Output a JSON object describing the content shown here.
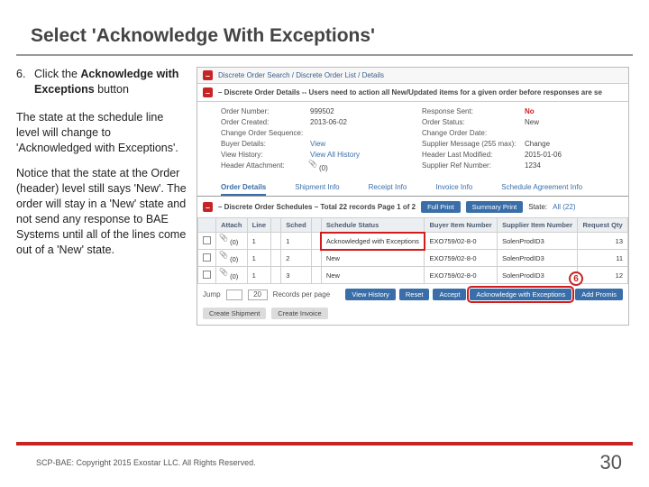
{
  "title": "Select 'Acknowledge With Exceptions'",
  "step": {
    "num": "6.",
    "text_pre": "Click the ",
    "bold": "Acknowledge with Exceptions",
    "text_post": " button"
  },
  "para1": "The state at the schedule line level will change to 'Acknowledged with Exceptions'.",
  "para2": "Notice that the state at the Order (header) level still says 'New'. The order will stay in a 'New' state and not send any response to BAE Systems until all of the lines come out of a 'New' state.",
  "crumb": "Discrete Order Search / Discrete Order List / Details",
  "notice": "– Discrete Order Details -- Users need to action all New/Updated items for a given order before responses are se",
  "details": {
    "order_number_lbl": "Order Number:",
    "order_number": "999502",
    "order_created_lbl": "Order Created:",
    "order_created": "2013-06-02",
    "chg_seq_lbl": "Change Order Sequence:",
    "chg_seq": "",
    "resp_sent_lbl": "Response Sent:",
    "resp_sent": "No",
    "order_status_lbl": "Order Status:",
    "order_status": "New",
    "chg_date_lbl": "Change Order Date:",
    "chg_date": "",
    "buyer_lbl": "Buyer Details:",
    "buyer": "View",
    "view_hist_lbl": "View History:",
    "view_hist": "View All History",
    "header_att_lbl": "Header Attachment:",
    "header_att": "(0)",
    "supp_msg_lbl": "Supplier Message (255 max):",
    "supp_msg": "Change",
    "head_mod_lbl": "Header Last Modified:",
    "head_mod": "2015-01-06",
    "supp_ref_lbl": "Supplier Ref Number:",
    "supp_ref": "1234"
  },
  "tabs": [
    "Order Details",
    "Shipment Info",
    "Receipt Info",
    "Invoice Info",
    "Schedule Agreement Info"
  ],
  "sched_bar": {
    "label": "– Discrete Order Schedules – Total 22 records Page 1 of 2",
    "b1": "Full Print",
    "b2": "Summary Print",
    "state_lbl": "State:",
    "state_val": "All (22)"
  },
  "tbl_head": [
    "",
    "Attach",
    "Line",
    "",
    "Sched",
    "",
    "Schedule Status",
    "Buyer Item Number",
    "Supplier Item Number",
    "Request Qty"
  ],
  "rows": [
    {
      "attach": "(0)",
      "line": "1",
      "sched": "1",
      "status": "Acknowledged with Exceptions",
      "buyer_item": "EXO759/02-8-0",
      "supp_item": "SolenProdID3",
      "qty": "13",
      "hl": true
    },
    {
      "attach": "(0)",
      "line": "1",
      "sched": "2",
      "status": "New",
      "buyer_item": "EXO759/02-8-0",
      "supp_item": "SolenProdID3",
      "qty": "11",
      "hl": false
    },
    {
      "attach": "(0)",
      "line": "1",
      "sched": "3",
      "status": "New",
      "buyer_item": "EXO759/02-8-0",
      "supp_item": "SolenProdID3",
      "qty": "12",
      "hl": false
    }
  ],
  "actions": {
    "jump": "Jump",
    "per": "Records per page",
    "per_val": "20",
    "view_history": "View History",
    "reset": "Reset",
    "accept": "Accept",
    "ack_exc": "Acknowledge with Exceptions",
    "add_prom": "Add Promis",
    "create_ship": "Create Shipment",
    "create_inv": "Create Invoice"
  },
  "callout": "6",
  "footer": "SCP-BAE: Copyright 2015 Exostar LLC. All Rights Reserved.",
  "page": "30"
}
